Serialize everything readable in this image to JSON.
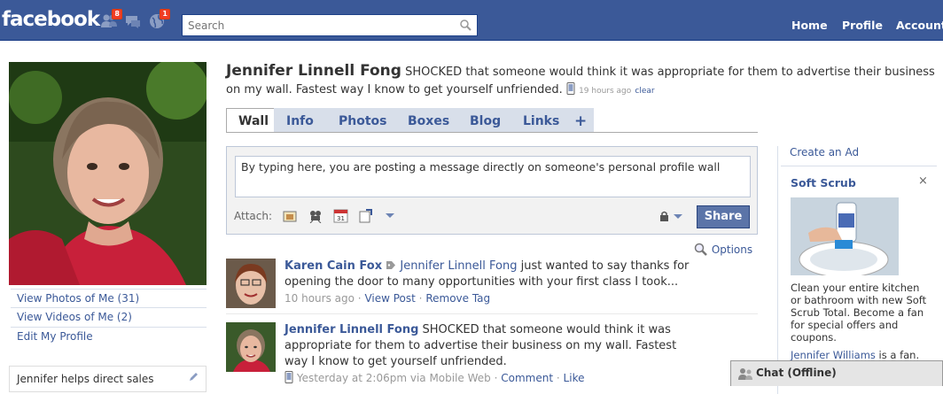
{
  "topbar": {
    "logo": "facebook",
    "friend_requests_badge": "8",
    "notifications_badge": "1",
    "search_placeholder": "Search",
    "nav": {
      "home": "Home",
      "profile": "Profile",
      "account": "Account"
    }
  },
  "left": {
    "links": [
      "View Photos of Me (31)",
      "View Videos of Me (2)",
      "Edit My Profile"
    ],
    "about": "Jennifer helps direct sales"
  },
  "header": {
    "name": "Jennifer Linnell Fong",
    "status": "SHOCKED that someone would think it was appropriate for them to advertise their business on my wall. Fastest way I know to get yourself unfriended.",
    "status_time": "19 hours ago",
    "status_clear": "clear",
    "tabs": [
      "Wall",
      "Info",
      "Photos",
      "Boxes",
      "Blog",
      "Links",
      "+"
    ]
  },
  "publisher": {
    "text": "By typing here, you are posting a message directly on someone's personal profile wall",
    "attach_label": "Attach:",
    "share_label": "Share"
  },
  "options_label": "Options",
  "stories": [
    {
      "actor": "Karen Cain Fox",
      "target": "Jennifer Linnell Fong",
      "text": "just wanted to say thanks for opening the door to many opportunities with your first class I took...",
      "meta_time": "10 hours ago",
      "meta_sep": "·",
      "action1": "View Post",
      "action2": "Remove Tag"
    },
    {
      "actor": "Jennifer Linnell Fong",
      "text": "SHOCKED that someone would think it was appropriate for them to advertise their business on my wall. Fastest way I know to get yourself unfriended.",
      "meta_time": "Yesterday at 2:06pm via Mobile Web",
      "meta_sep": "·",
      "action1": "Comment",
      "action2": "Like"
    }
  ],
  "right": {
    "create_ad": "Create an Ad",
    "ad_title": "Soft Scrub",
    "ad_close": "×",
    "ad_text": "Clean your entire kitchen or bathroom with new Soft Scrub Total. Become a fan for special offers and coupons.",
    "ad_fan_name": "Jennifer Williams",
    "ad_fan_suffix": " is a fan."
  },
  "chat": {
    "label": "Chat (Offline)"
  },
  "colors": {
    "brand": "#3b5998",
    "badge": "#f03d25",
    "share": "#5b74a8"
  }
}
